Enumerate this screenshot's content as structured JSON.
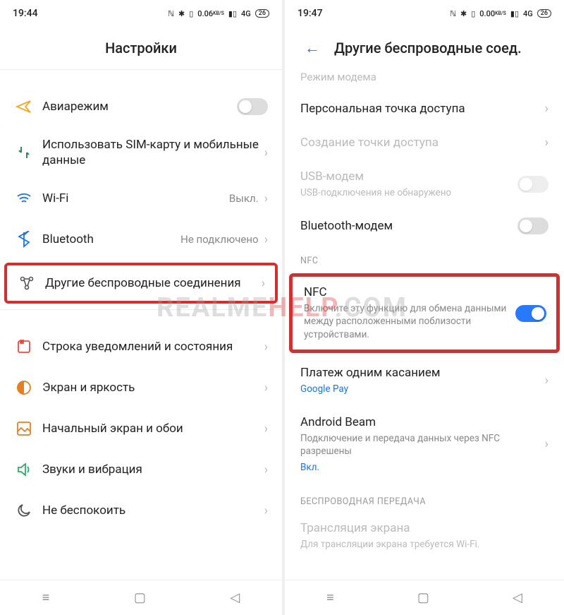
{
  "watermark": {
    "grey": "REALME",
    "red": "HELP",
    "suffix": ".COM"
  },
  "left": {
    "status": {
      "time": "19:44",
      "net": "0.06",
      "netUnit": "KB/S",
      "cell": "4G",
      "batt": "26"
    },
    "header": "Настройки",
    "items": {
      "airplane": "Авиарежим",
      "sim": "Использовать SIM-карту и мобильные данные",
      "wifi": {
        "label": "Wi-Fi",
        "value": "Выкл."
      },
      "bluetooth": {
        "label": "Bluetooth",
        "value": "Не подключено"
      },
      "wireless": "Другие беспроводные соединения",
      "notif": "Строка уведомлений и состояния",
      "display": "Экран и яркость",
      "home": "Начальный экран и обои",
      "sound": "Звуки и вибрация",
      "dnd": "Не беспокоить"
    }
  },
  "right": {
    "status": {
      "time": "19:47",
      "net": "0.00",
      "netUnit": "KB/S",
      "cell": "4G",
      "batt": "26"
    },
    "header": "Другие беспроводные соед.",
    "partial": "Режим модема",
    "hotspot": "Персональная точка доступа",
    "create_hotspot": "Создание точки доступа",
    "usb": {
      "label": "USB-модем",
      "sub": "USB-подключения не обнаружено"
    },
    "bt_modem": "Bluetooth-модем",
    "nfc_section": "NFC",
    "nfc": {
      "label": "NFC",
      "sub": "Включите эту функцию для обмена данными между расположенными поблизости устройствами."
    },
    "tap_pay": {
      "label": "Платеж одним касанием",
      "sub": "Google Pay"
    },
    "beam": {
      "label": "Android Beam",
      "sub": "Подключение и передача данных через NFC разрешены",
      "state": "Вкл."
    },
    "wireless_tx_section": "БЕСПРОВОДНАЯ ПЕРЕДАЧА",
    "cast": {
      "label": "Трансляция экрана",
      "sub": "Для трансляции экрана требуется Wi-Fi."
    }
  }
}
